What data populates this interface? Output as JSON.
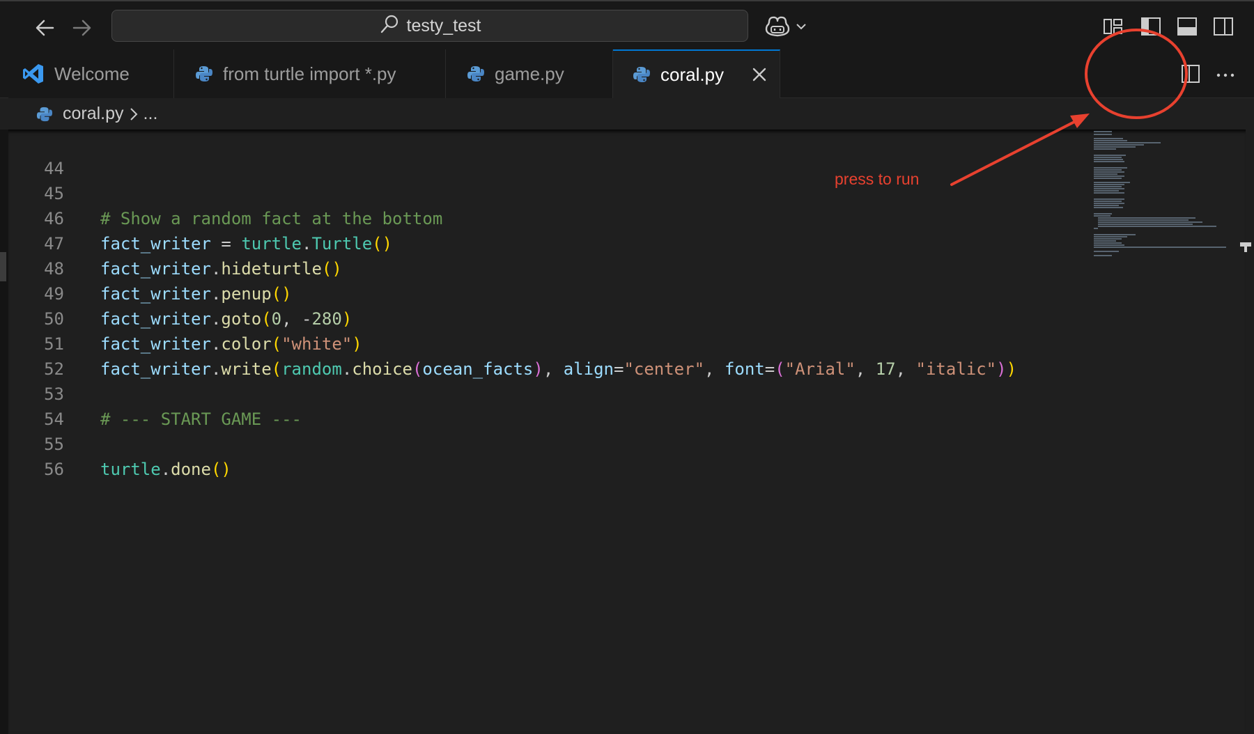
{
  "titlebar": {
    "search_text": "testy_test",
    "icons": [
      "back-arrow-icon",
      "forward-arrow-icon",
      "search-icon",
      "copilot-icon",
      "chevron-down-icon",
      "customize-layout-icon",
      "toggle-primary-sidebar-icon",
      "toggle-panel-icon",
      "toggle-secondary-sidebar-icon"
    ]
  },
  "tabs": [
    {
      "label": "Welcome",
      "icon": "vscode-logo-icon",
      "active": false
    },
    {
      "label": "from turtle import *.py",
      "icon": "python-icon",
      "active": false
    },
    {
      "label": "game.py",
      "icon": "python-icon",
      "active": false
    },
    {
      "label": "coral.py",
      "icon": "python-icon",
      "active": true
    }
  ],
  "editor_actions": [
    "run-python-file-icon",
    "chevron-down-icon",
    "split-editor-icon",
    "more-actions-icon"
  ],
  "breadcrumb": {
    "file": "coral.py",
    "rest": "..."
  },
  "code": {
    "line_numbers": [
      "44",
      "45",
      "46",
      "47",
      "48",
      "49",
      "50",
      "51",
      "52",
      "53",
      "54",
      "55",
      "56"
    ],
    "l45_comment": "# Show a random fact at the bottom",
    "l53_comment": "# --- START GAME ---",
    "fact_writer": "fact_writer",
    "turtle": "turtle",
    "Turtle": "Turtle",
    "random": "random",
    "ocean_facts": "ocean_facts",
    "hideturtle": "hideturtle",
    "penup": "penup",
    "goto": "goto",
    "color": "color",
    "write": "write",
    "choice": "choice",
    "done": "done",
    "align": "align",
    "font": "font",
    "n0": "0",
    "n280": "280",
    "n17": "17",
    "s_white": "\"white\"",
    "s_center": "\"center\"",
    "s_arial": "\"Arial\"",
    "s_italic": "\"italic\""
  },
  "annotation": {
    "text": "press to run",
    "color": "#e8412f"
  },
  "colors": {
    "accent": "#0078d4",
    "editor_bg": "#1f1f1f",
    "chrome_bg": "#181818"
  }
}
